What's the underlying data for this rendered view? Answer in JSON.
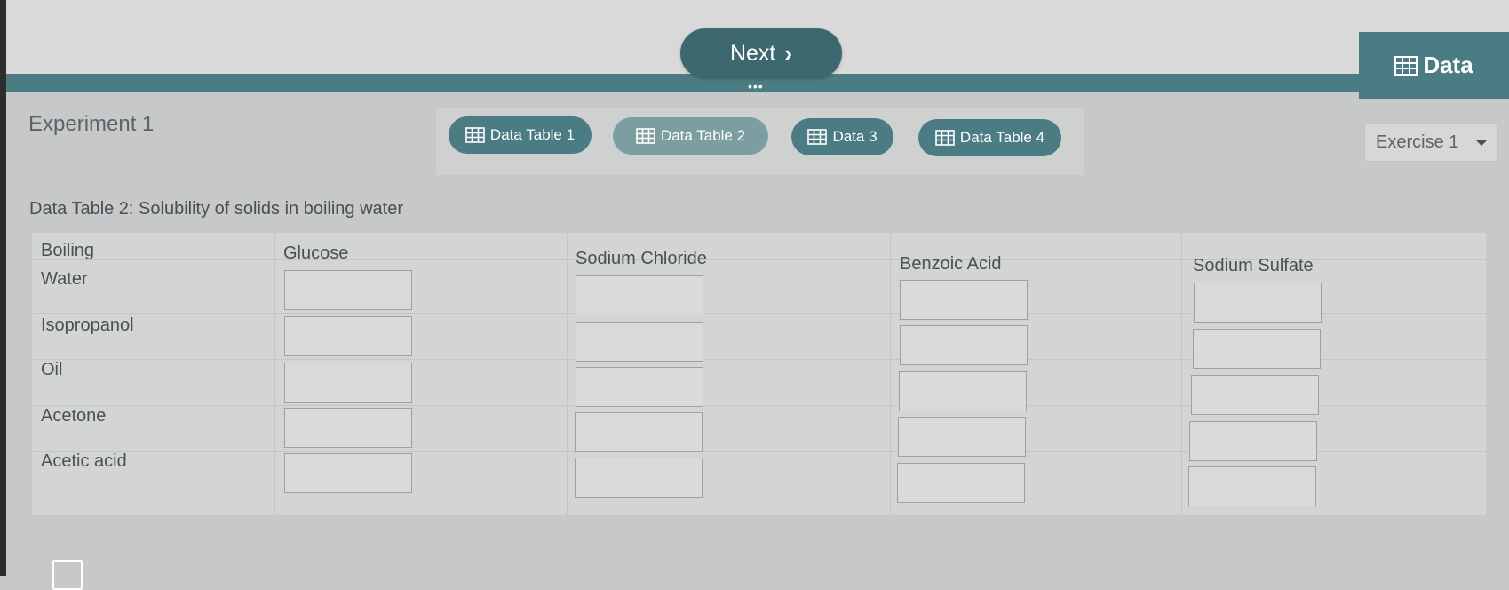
{
  "header": {
    "next_label": "Next",
    "data_label": "Data"
  },
  "experiment": {
    "title": "Experiment 1"
  },
  "tabs": [
    {
      "label": "Data Table 1",
      "active": false
    },
    {
      "label": "Data Table 2",
      "active": true
    },
    {
      "label": "Data 3",
      "active": false
    },
    {
      "label": "Data Table 4",
      "active": false
    }
  ],
  "exercise_select": {
    "value": "Exercise 1"
  },
  "table": {
    "caption": "Data Table 2: Solubility of solids in boiling water",
    "corner_header": [
      "Boiling",
      "Water"
    ],
    "columns": [
      "Glucose",
      "Sodium Chloride",
      "Benzoic Acid",
      "Sodium Sulfate"
    ],
    "rows": [
      "Isopropanol",
      "Oil",
      "Acetone",
      "Acetic acid"
    ]
  },
  "colors": {
    "teal": "#4c7c83",
    "teal_dark": "#3d6870",
    "active_tab": "#7d9ea1"
  }
}
